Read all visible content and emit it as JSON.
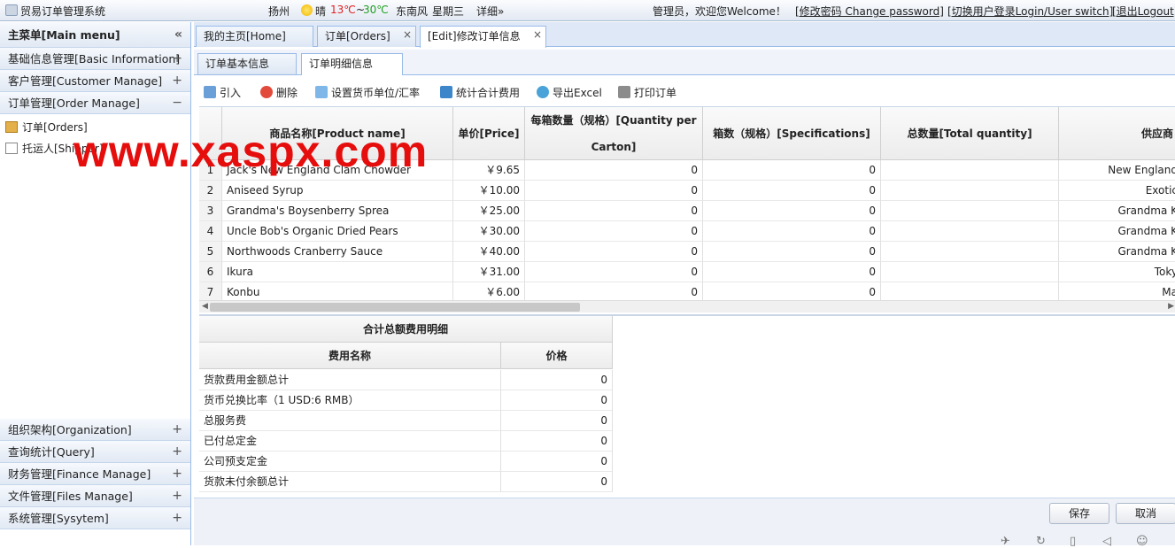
{
  "header": {
    "app_title": "贸易订单管理系统",
    "city": "扬州",
    "weather": "晴",
    "temp_low": "13℃",
    "temp_sep": "~",
    "temp_high": "30℃",
    "wind": "东南风",
    "weekday": "星期三",
    "detail": "详细»",
    "welcome": "管理员，欢迎您Welcome！",
    "change_password": "[修改密码 Change password]",
    "user_switch": "[切换用户登录Login/User switch]",
    "logout": "[退出Logout]"
  },
  "sidebar": {
    "title": "主菜单[Main menu]",
    "collapse": "«",
    "groups_top": [
      {
        "label": "基础信息管理[Basic Information]",
        "toggle": "+"
      },
      {
        "label": "客户管理[Customer Manage]",
        "toggle": "+"
      },
      {
        "label": "订单管理[Order Manage]",
        "toggle": "−"
      }
    ],
    "items": [
      {
        "label": "订单[Orders]"
      },
      {
        "label": "托运人[Shipper]"
      }
    ],
    "groups_bottom": [
      {
        "label": "组织架构[Organization]",
        "toggle": "+"
      },
      {
        "label": "查询统计[Query]",
        "toggle": "+"
      },
      {
        "label": "财务管理[Finance Manage]",
        "toggle": "+"
      },
      {
        "label": "文件管理[Files Manage]",
        "toggle": "+"
      },
      {
        "label": "系统管理[Sysytem]",
        "toggle": "+"
      }
    ]
  },
  "tabs": [
    {
      "label": "我的主页[Home]"
    },
    {
      "label": "订单[Orders]",
      "close": "×"
    },
    {
      "label": "[Edit]修改订单信息",
      "close": "×"
    }
  ],
  "subtabs": [
    {
      "label": "订单基本信息"
    },
    {
      "label": "订单明细信息"
    }
  ],
  "toolbar": {
    "import": "引入",
    "delete": "删除",
    "currency": "设置货币单位/汇率",
    "stats": "统计合计费用",
    "excel": "导出Excel",
    "print": "打印订单"
  },
  "grid": {
    "headers": [
      "商品名称[Product name]",
      "单价[Price]",
      "每箱数量（规格）[Quantity per Carton]",
      "箱数（规格）[Specifications]",
      "总数量[Total quantity]",
      "供应商"
    ],
    "rows": [
      {
        "n": "1",
        "name": "Jack's New England Clam Chowder",
        "price": "￥9.65",
        "qty": "0",
        "spec": "0",
        "total": "",
        "supplier": "New England"
      },
      {
        "n": "2",
        "name": "Aniseed Syrup",
        "price": "￥10.00",
        "qty": "0",
        "spec": "0",
        "total": "",
        "supplier": "Exotic"
      },
      {
        "n": "3",
        "name": "Grandma's Boysenberry Sprea",
        "price": "￥25.00",
        "qty": "0",
        "spec": "0",
        "total": "",
        "supplier": "Grandma K"
      },
      {
        "n": "4",
        "name": "Uncle Bob's Organic Dried Pears",
        "price": "￥30.00",
        "qty": "0",
        "spec": "0",
        "total": "",
        "supplier": "Grandma K"
      },
      {
        "n": "5",
        "name": "Northwoods Cranberry Sauce",
        "price": "￥40.00",
        "qty": "0",
        "spec": "0",
        "total": "",
        "supplier": "Grandma K"
      },
      {
        "n": "6",
        "name": "Ikura",
        "price": "￥31.00",
        "qty": "0",
        "spec": "0",
        "total": "",
        "supplier": "Toky"
      },
      {
        "n": "7",
        "name": "Konbu",
        "price": "￥6.00",
        "qty": "0",
        "spec": "0",
        "total": "",
        "supplier": "Ma"
      }
    ]
  },
  "summary": {
    "title": "合计总额费用明细",
    "col_name": "费用名称",
    "col_price": "价格",
    "rows": [
      {
        "name": "货款费用金额总计",
        "value": "0"
      },
      {
        "name": "货币兑换比率（1 USD:6 RMB）",
        "value": "0"
      },
      {
        "name": "总服务费",
        "value": "0"
      },
      {
        "name": "已付总定金",
        "value": "0"
      },
      {
        "name": "公司预支定金",
        "value": "0"
      },
      {
        "name": "货款未付余额总计",
        "value": "0"
      }
    ]
  },
  "buttons": {
    "save": "保存",
    "cancel": "取消"
  },
  "watermark": "www.xaspx.com",
  "colors": {
    "accent": "#99bbe8",
    "watermark": "#e60d0d",
    "temp_low": "#e22222",
    "temp_high": "#22a022"
  }
}
